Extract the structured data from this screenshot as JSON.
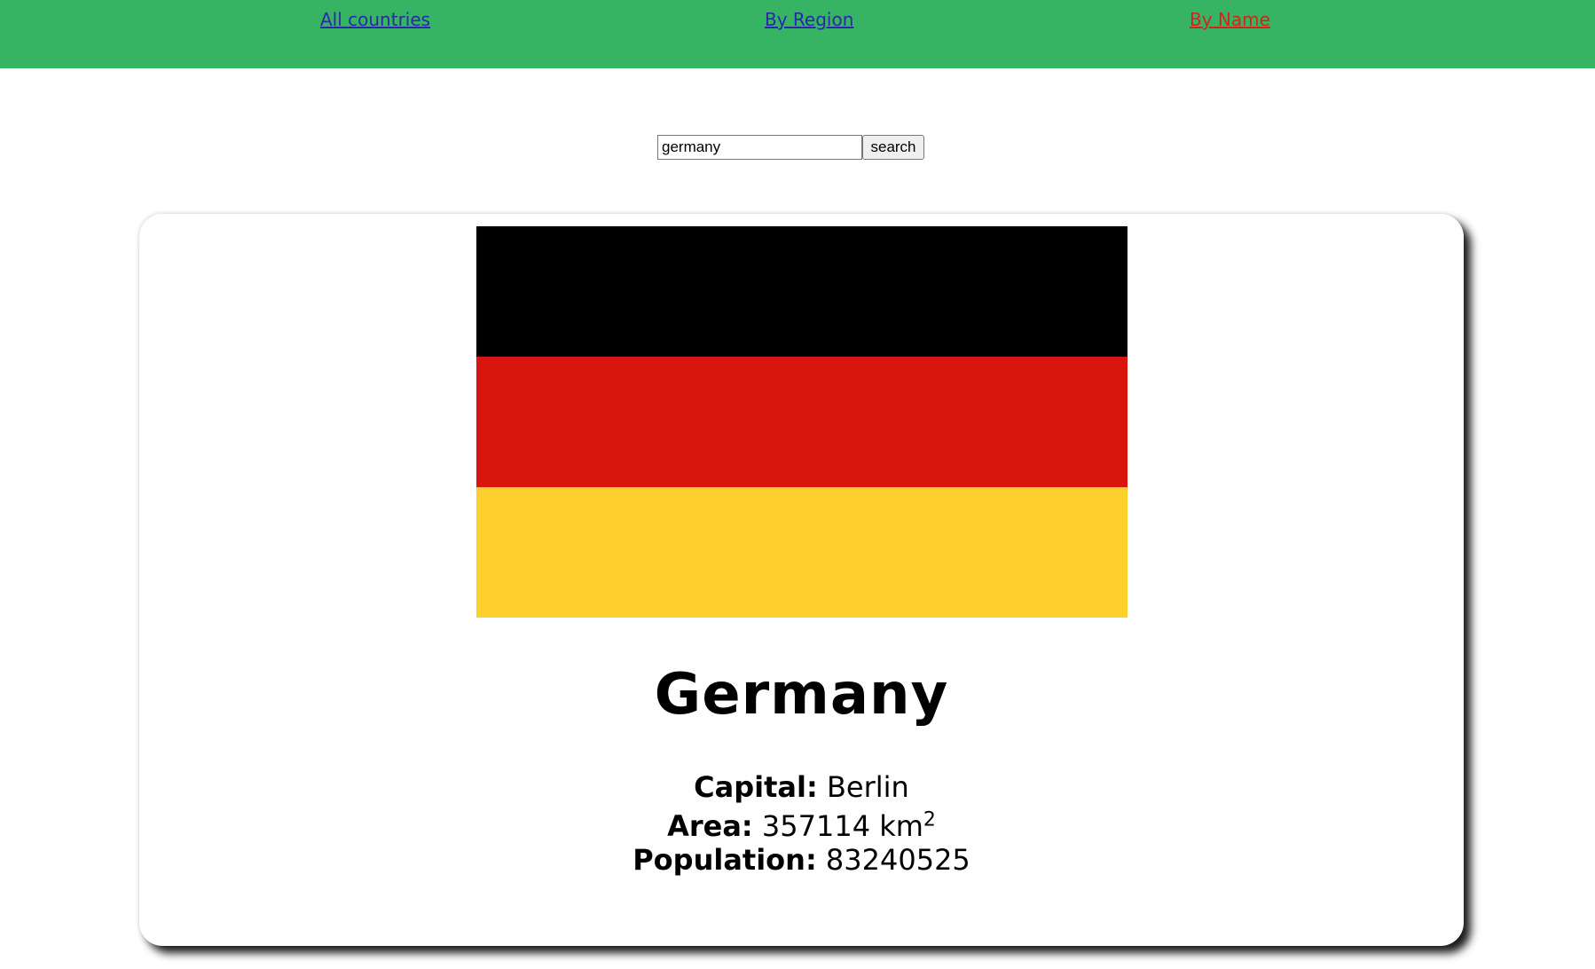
{
  "nav": {
    "all_countries": "All countries",
    "by_region": "By Region",
    "by_name": "By Name",
    "link_color": "#2a2aa6",
    "active_color": "#d0261a",
    "bar_color": "#36b363"
  },
  "search": {
    "value": "germany",
    "button_label": "search"
  },
  "country": {
    "name": "Germany",
    "flag_colors": [
      "#000000",
      "#d8160d",
      "#fdcf2d"
    ],
    "capital_label": "Capital:",
    "capital": "Berlin",
    "area_label": "Area:",
    "area": "357114 km",
    "area_superscript": "2",
    "population_label": "Population:",
    "population": "83240525"
  }
}
